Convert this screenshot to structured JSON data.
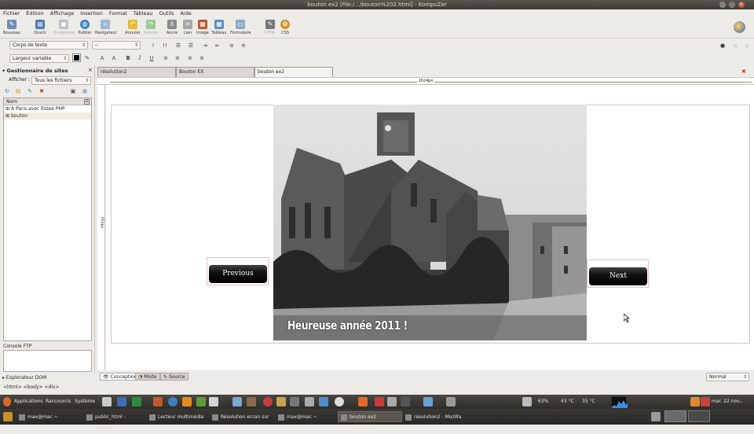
{
  "window": {
    "title": "bouton ex2 [file:/.../bouton%202.html] - KompoZer"
  },
  "menu": [
    "Fichier",
    "Édition",
    "Affichage",
    "Insertion",
    "Format",
    "Tableau",
    "Outils",
    "Aide"
  ],
  "toolbar": {
    "items": [
      {
        "label": "Nouveau",
        "icon": "new-document-icon"
      },
      {
        "label": "Ouvrir",
        "icon": "open-folder-icon"
      },
      {
        "label": "Enregistrer",
        "icon": "save-icon",
        "disabled": true
      },
      {
        "label": "Publier",
        "icon": "publish-globe-icon"
      },
      {
        "label": "Navigateur",
        "icon": "browser-icon"
      },
      {
        "label": "Annuler",
        "icon": "undo-icon"
      },
      {
        "label": "Refaire",
        "icon": "redo-icon",
        "disabled": true
      },
      {
        "label": "Ancre",
        "icon": "anchor-icon"
      },
      {
        "label": "Lien",
        "icon": "link-icon"
      },
      {
        "label": "Image",
        "icon": "image-icon"
      },
      {
        "label": "Tableau",
        "icon": "table-icon"
      },
      {
        "label": "Formulaire",
        "icon": "form-icon"
      },
      {
        "label": "HTML",
        "icon": "html-icon",
        "disabled": true
      },
      {
        "label": "CSS",
        "icon": "css-icon"
      }
    ]
  },
  "format": {
    "paragraph_style": "Corps de texte",
    "class_combo": "--",
    "font": "Largeur variable"
  },
  "sidebar": {
    "title": "Gestionnaire de sites",
    "show_label": "Afficher :",
    "show_value": "Tous les fichiers",
    "column": "Nom",
    "items": [
      "A Paris avec Estee PHP",
      "bouton"
    ],
    "console_label": "Console FTP",
    "dom_label": "Explorateur DOM"
  },
  "tabs": [
    {
      "label": "résolution2",
      "active": false
    },
    {
      "label": "Bouton EX",
      "active": false
    },
    {
      "label": "bouton ex2",
      "active": true
    }
  ],
  "ruler": {
    "width_label": "1624px",
    "height_label": "651px"
  },
  "slideshow": {
    "caption": "Heureuse année 2011 !",
    "prev_label": "Previous",
    "next_label": "Next"
  },
  "modes": [
    {
      "label": "Conception",
      "active": true
    },
    {
      "label": "Mixte",
      "active": false
    },
    {
      "label": "Source",
      "active": false
    }
  ],
  "status_combo": "Normal",
  "tag_path": "<html> <body> <div>",
  "panel": {
    "applications": "Applications",
    "places": "Raccourcis",
    "system": "Système",
    "battery": "63%",
    "temp1": "43 °C",
    "temp2": "35 °C",
    "clock": "mar. 22 nov., 19:32"
  },
  "taskbar": [
    {
      "label": "max@mac ~",
      "active": false
    },
    {
      "label": "public_html - Navigat...",
      "active": false
    },
    {
      "label": "Lecteur multimédia ...",
      "active": false
    },
    {
      "label": "Résolution ecran sur ...",
      "active": false
    },
    {
      "label": "max@mac ~",
      "active": false
    },
    {
      "label": "bouton ex2 [file:/.../b...",
      "active": true
    },
    {
      "label": "résolution2 - Mozilla ...",
      "active": false
    }
  ]
}
